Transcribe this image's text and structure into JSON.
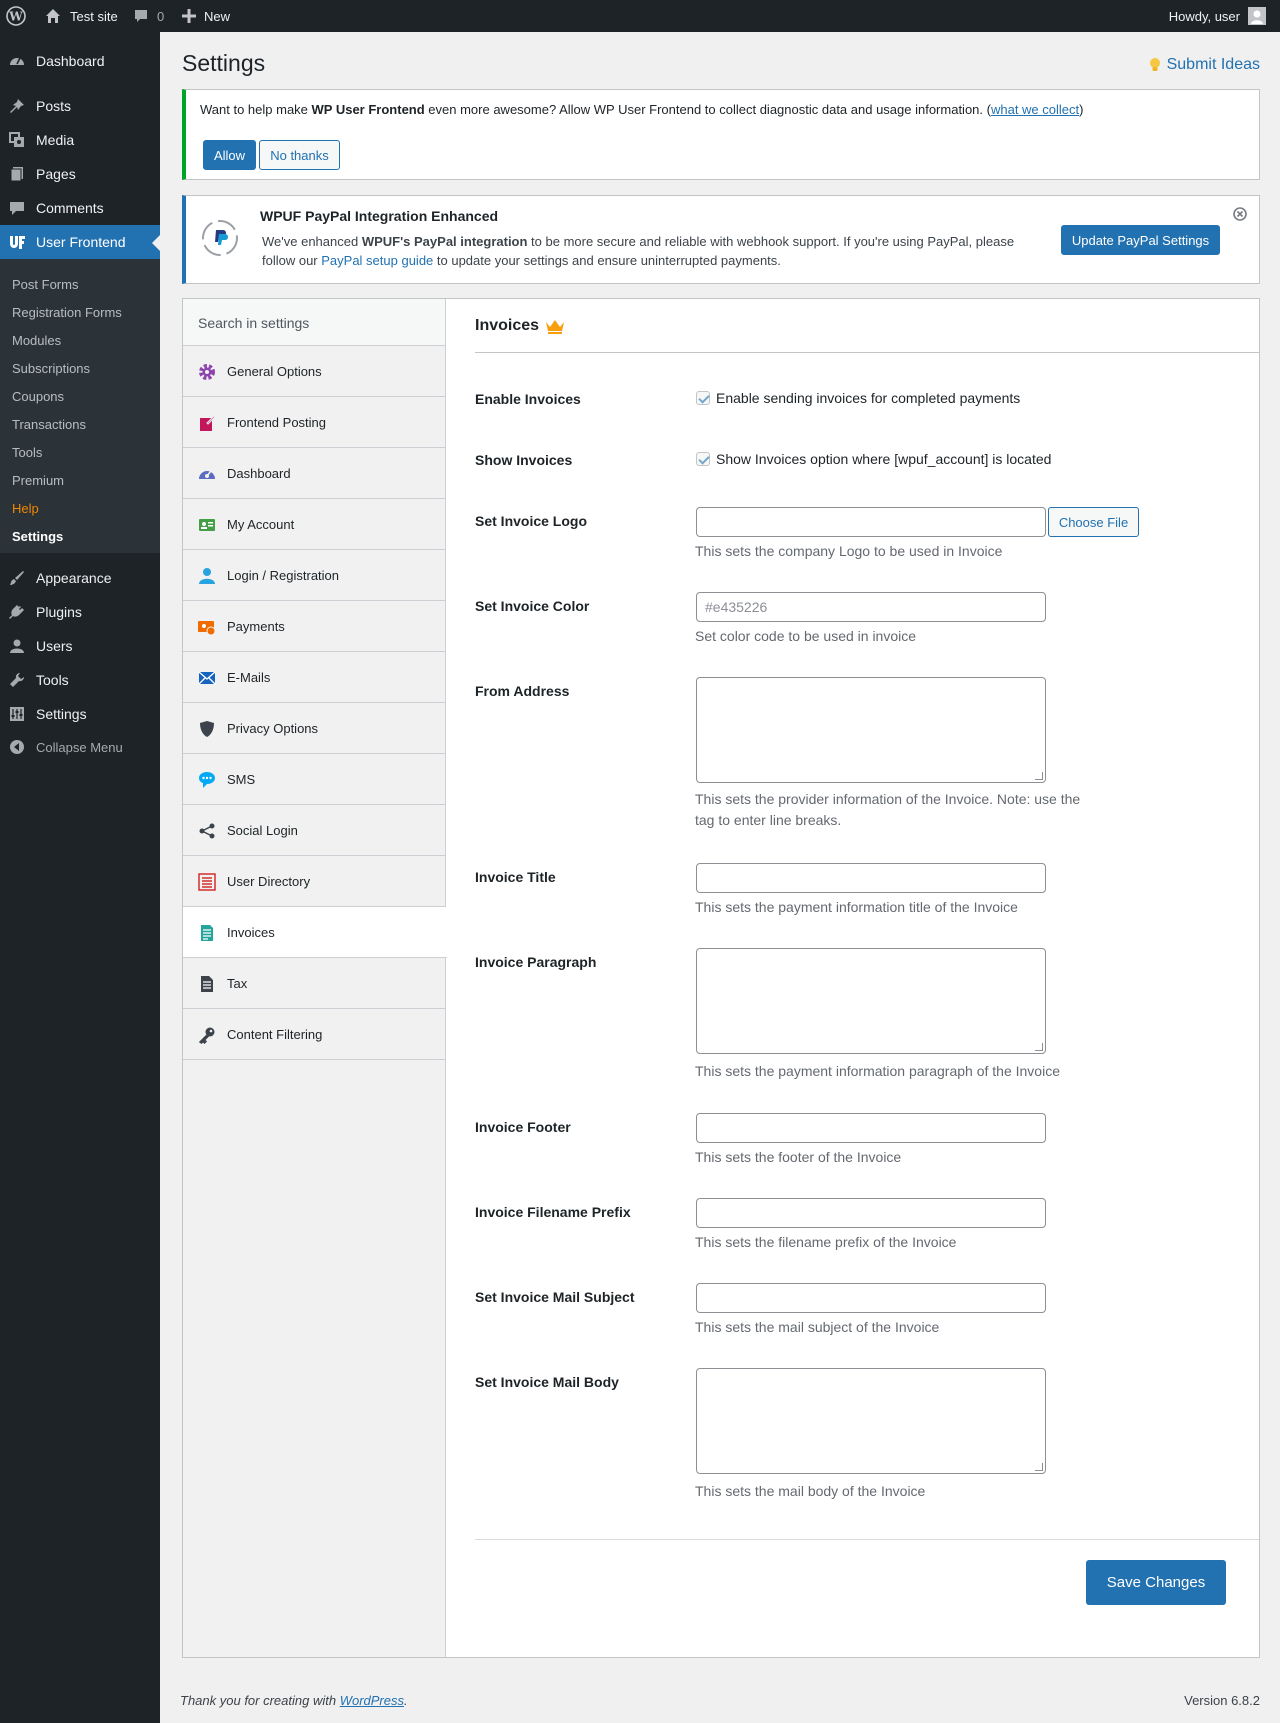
{
  "admin_bar": {
    "site_name": "Test site",
    "comments_count": "0",
    "new_label": "New",
    "howdy": "Howdy, user"
  },
  "sidebar": {
    "menu": [
      {
        "label": "Dashboard",
        "icon": "dashboard-icon"
      },
      {
        "label": "Posts",
        "icon": "pin-icon"
      },
      {
        "label": "Media",
        "icon": "media-icon"
      },
      {
        "label": "Pages",
        "icon": "pages-icon"
      },
      {
        "label": "Comments",
        "icon": "comment-icon"
      },
      {
        "label": "User Frontend",
        "icon": "wpuf-icon"
      }
    ],
    "submenu": [
      "Post Forms",
      "Registration Forms",
      "Modules",
      "Subscriptions",
      "Coupons",
      "Transactions",
      "Tools",
      "Premium",
      "Help",
      "Settings"
    ],
    "menu2": [
      {
        "label": "Appearance",
        "icon": "brush-icon"
      },
      {
        "label": "Plugins",
        "icon": "plugin-icon"
      },
      {
        "label": "Users",
        "icon": "users-icon"
      },
      {
        "label": "Tools",
        "icon": "wrench-icon"
      },
      {
        "label": "Settings",
        "icon": "settings-icon"
      }
    ],
    "collapse": "Collapse Menu"
  },
  "page": {
    "title": "Settings",
    "submit_ideas": "Submit Ideas"
  },
  "notice_tracking": {
    "text_a": "Want to help make ",
    "text_b": "WP User Frontend",
    "text_c": " even more awesome? Allow WP User Frontend to collect diagnostic data and usage information. (",
    "link": "what we collect",
    "text_d": ")",
    "allow": "Allow",
    "no_thanks": "No thanks"
  },
  "notice_paypal": {
    "title": "WPUF PayPal Integration Enhanced",
    "msg_a": "We've enhanced ",
    "msg_b": "WPUF's PayPal integration",
    "msg_c": " to be more secure and reliable with webhook support. If you're using PayPal, please follow our ",
    "link": "PayPal setup guide",
    "msg_d": " to update your settings and ensure uninterrupted payments.",
    "button": "Update PayPal Settings"
  },
  "settings_nav": {
    "search_placeholder": "Search in settings",
    "items": [
      {
        "label": "General Options",
        "icon": "gear-icon",
        "color": "#8e44ad"
      },
      {
        "label": "Frontend Posting",
        "icon": "edit-icon",
        "color": "#c2185b"
      },
      {
        "label": "Dashboard",
        "icon": "dashboard-icon",
        "color": "#5c6bc0"
      },
      {
        "label": "My Account",
        "icon": "account-card-icon",
        "color": "#43a047"
      },
      {
        "label": "Login / Registration",
        "icon": "user-icon",
        "color": "#29a3e0"
      },
      {
        "label": "Payments",
        "icon": "payments-icon",
        "color": "#ef6c00"
      },
      {
        "label": "E-Mails",
        "icon": "email-icon",
        "color": "#1565c0"
      },
      {
        "label": "Privacy Options",
        "icon": "shield-icon",
        "color": "#3c434a"
      },
      {
        "label": "SMS",
        "icon": "sms-icon",
        "color": "#03a9f4"
      },
      {
        "label": "Social Login",
        "icon": "share-icon",
        "color": "#3c434a"
      },
      {
        "label": "User Directory",
        "icon": "list-icon",
        "color": "#d32f2f"
      },
      {
        "label": "Invoices",
        "icon": "invoice-icon",
        "color": "#26a69a"
      },
      {
        "label": "Tax",
        "icon": "document-icon",
        "color": "#3c434a"
      },
      {
        "label": "Content Filtering",
        "icon": "key-icon",
        "color": "#3c434a"
      }
    ]
  },
  "invoices": {
    "title": "Invoices",
    "enable_label": "Enable Invoices",
    "enable_text": "Enable sending invoices for completed payments",
    "show_label": "Show Invoices",
    "show_text": "Show Invoices option where [wpuf_account] is located",
    "logo_label": "Set Invoice Logo",
    "choose_file": "Choose File",
    "logo_desc": "This sets the company Logo to be used in Invoice",
    "color_label": "Set Invoice Color",
    "color_placeholder": "#e435226",
    "color_desc": "Set color code to be used in invoice",
    "from_label": "From Address",
    "from_desc": "This sets the provider information of the Invoice. Note: use the tag to enter line breaks.",
    "title_label": "Invoice Title",
    "title_desc": "This sets the payment information title of the Invoice",
    "para_label": "Invoice Paragraph",
    "para_desc": "This sets the payment information paragraph of the Invoice",
    "footer_label": "Invoice Footer",
    "footer_desc": "This sets the footer of the Invoice",
    "prefix_label": "Invoice Filename Prefix",
    "prefix_desc": "This sets the filename prefix of the Invoice",
    "subject_label": "Set Invoice Mail Subject",
    "subject_desc": "This sets the mail subject of the Invoice",
    "body_label": "Set Invoice Mail Body",
    "body_desc": "This sets the mail body of the Invoice",
    "save": "Save Changes"
  },
  "footer": {
    "text": "Thank you for creating with ",
    "link": "WordPress",
    "end": ".",
    "version": "Version 6.8.2"
  }
}
